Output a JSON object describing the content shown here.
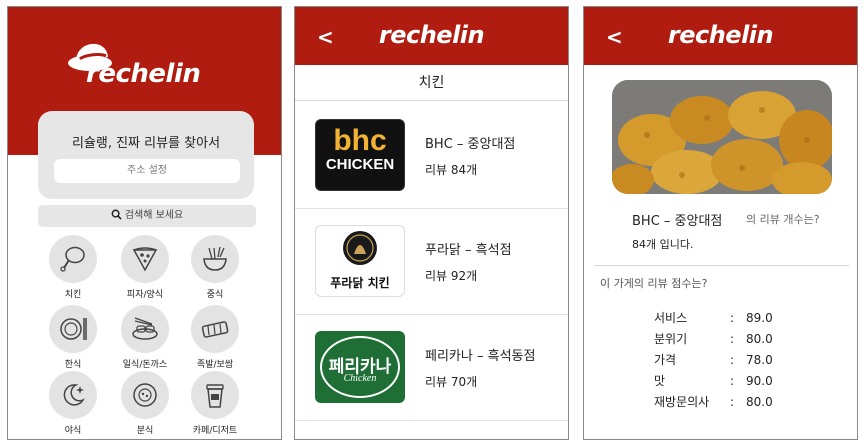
{
  "screen1": {
    "logo": "rechelin",
    "headline": "리슐랭, 진짜 리뷰를 찾아서",
    "address_button": "주소 설정",
    "search_placeholder": "검색해 보세요",
    "categories": [
      "치킨",
      "피자/양식",
      "중식",
      "한식",
      "일식/돈까스",
      "족발/보쌈",
      "야식",
      "분식",
      "카페/디저트"
    ]
  },
  "screen2": {
    "logo": "rechelin",
    "category_title": "치킨",
    "items": [
      {
        "name": "BHC – 중앙대점",
        "reviews": "리뷰 84개",
        "logo_lines": [
          "bhc",
          "CHICKEN"
        ]
      },
      {
        "name": "푸라닭 – 흑석점",
        "reviews": "리뷰 92개",
        "logo_lines": [
          "푸라닭 치킨"
        ]
      },
      {
        "name": "페리카나 – 흑석동점",
        "reviews": "리뷰 70개",
        "logo_lines": [
          "페리카나",
          "Chicken"
        ]
      }
    ]
  },
  "screen3": {
    "logo": "rechelin",
    "store_name": "BHC – 중앙대점",
    "review_question": "의 리뷰 개수는?",
    "review_count": "84개 입니다.",
    "score_heading": "이 가게의 리뷰 점수는?",
    "scores": [
      {
        "label": "서비스",
        "value": "89.0"
      },
      {
        "label": "분위기",
        "value": "80.0"
      },
      {
        "label": "가격",
        "value": "78.0"
      },
      {
        "label": "맛",
        "value": "90.0"
      },
      {
        "label": "재방문의사",
        "value": "80.0"
      }
    ]
  },
  "colors": {
    "brand_red": "#b11c10",
    "bhc_gold": "#f2b233",
    "pericana_green": "#1f6e36"
  }
}
